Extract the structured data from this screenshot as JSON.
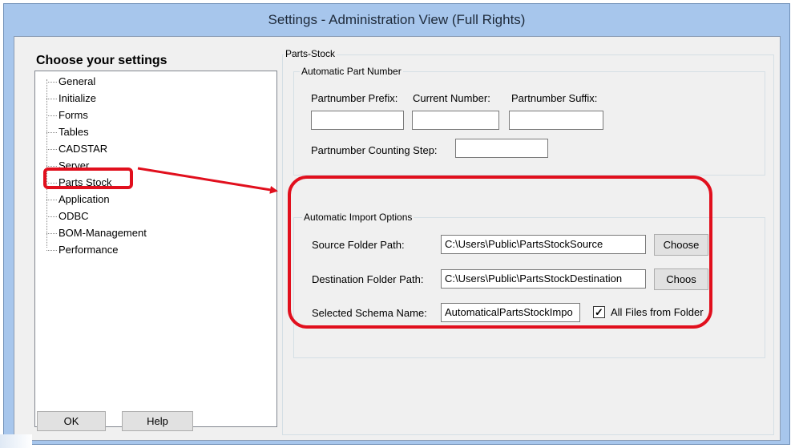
{
  "window": {
    "title": "Settings - Administration View (Full Rights)"
  },
  "left_panel": {
    "title": "Choose your settings",
    "tree_items": [
      "General",
      "Initialize",
      "Forms",
      "Tables",
      "CADSTAR",
      "Server",
      "Parts Stock",
      "Application",
      "ODBC",
      "BOM-Management",
      "Performance"
    ],
    "selected_item": "Parts Stock",
    "ok_label": "OK",
    "help_label": "Help"
  },
  "main": {
    "section_title": "Parts-Stock",
    "automatic_part_number": {
      "legend": "Automatic Part Number",
      "prefix_label": "Partnumber Prefix:",
      "current_label": "Current Number:",
      "suffix_label": "Partnumber Suffix:",
      "prefix_value": "",
      "current_value": "",
      "suffix_value": "",
      "step_label": "Partnumber Counting Step:",
      "step_value": ""
    },
    "automatic_import": {
      "legend": "Automatic Import Options",
      "source_label": "Source Folder Path:",
      "source_value": "C:\\Users\\Public\\PartsStockSource",
      "source_button": "Choose",
      "destination_label": "Destination Folder Path:",
      "destination_value": "C:\\Users\\Public\\PartsStockDestination",
      "destination_button": "Choos",
      "schema_label": "Selected Schema Name:",
      "schema_value": "AutomaticalPartsStockImpo",
      "all_files_label": "All Files from Folder",
      "all_files_checked": true
    }
  },
  "annotation_color": "#e10f1d"
}
